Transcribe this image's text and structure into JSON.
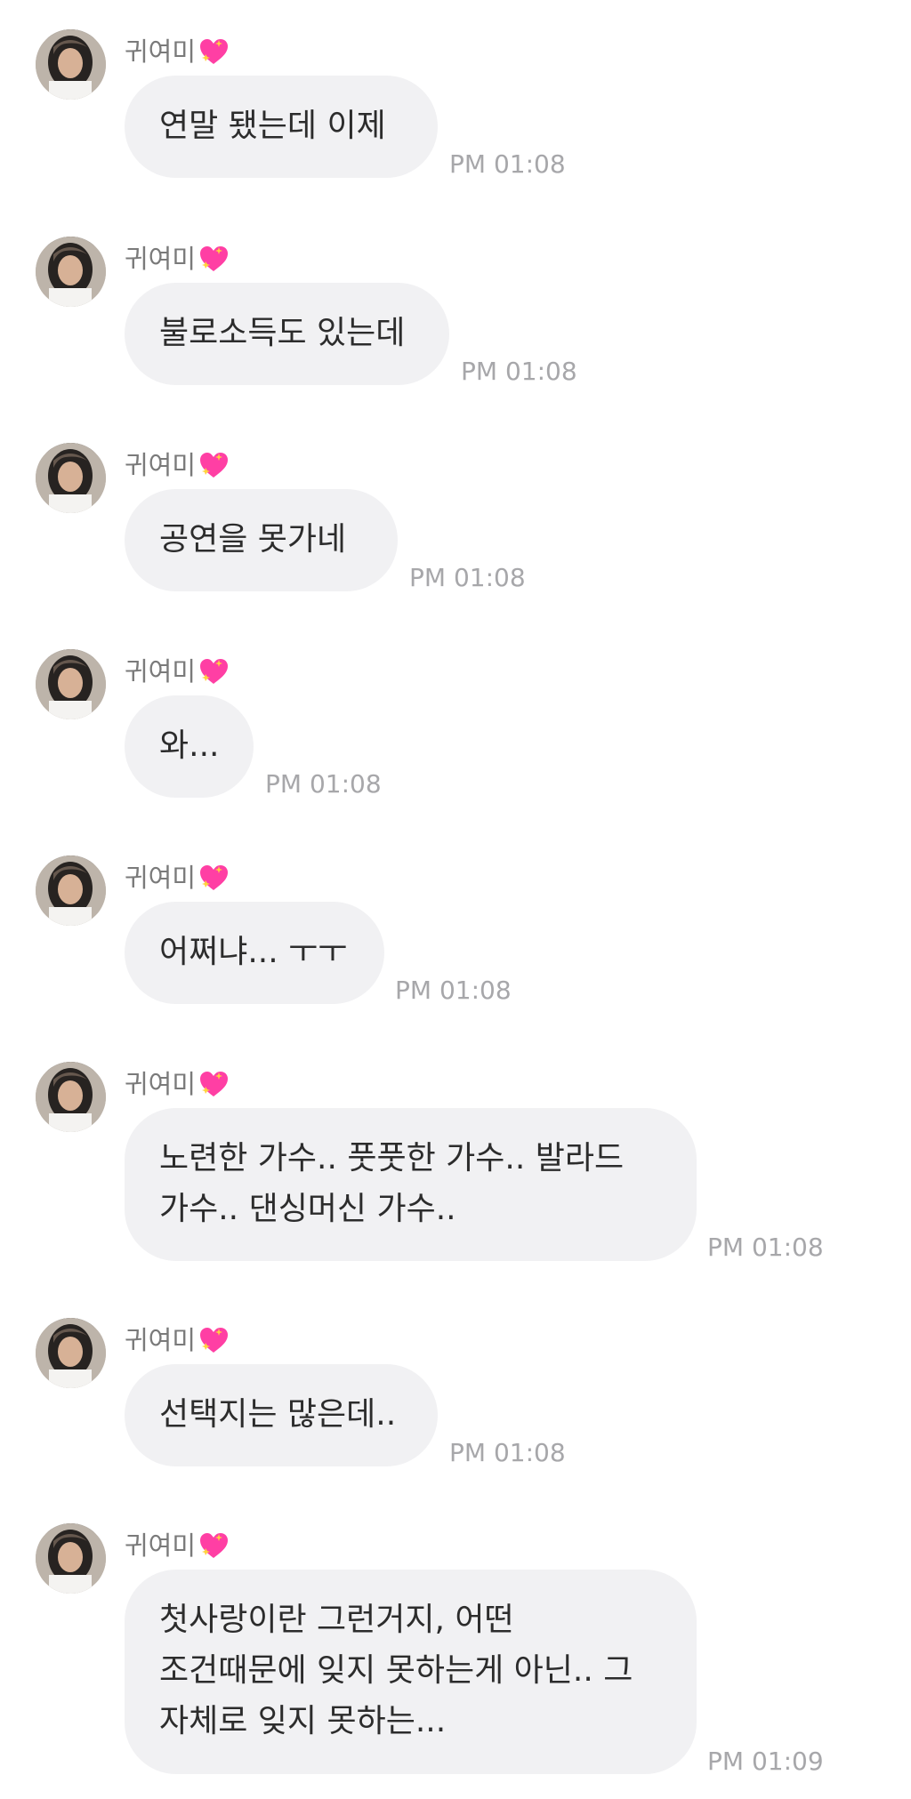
{
  "sender": {
    "name": "귀여미",
    "badge_icon": "sparkling-heart-icon"
  },
  "messages": [
    {
      "text": "연말 됐는데 이제",
      "time": "PM 01:08"
    },
    {
      "text": "불로소득도 있는데",
      "time": "PM 01:08"
    },
    {
      "text": "공연을 못가네",
      "time": "PM 01:08"
    },
    {
      "text": "와...",
      "time": "PM 01:08"
    },
    {
      "text": "어쩌냐... ㅜㅜ",
      "time": "PM 01:08"
    },
    {
      "text": "노련한 가수.. 풋풋한 가수.. 발라드\n가수.. 댄싱머신 가수..",
      "time": "PM 01:08"
    },
    {
      "text": "선택지는 많은데..",
      "time": "PM 01:08"
    },
    {
      "text": "첫사랑이란 그런거지, 어떤\n조건때문에 잊지 못하는게 아닌.. 그\n자체로 잊지 못하는...",
      "time": "PM 01:09"
    }
  ],
  "colors": {
    "bubble": "#f1f1f3",
    "time": "#a7a7aa",
    "sender": "#7a7a7a"
  }
}
